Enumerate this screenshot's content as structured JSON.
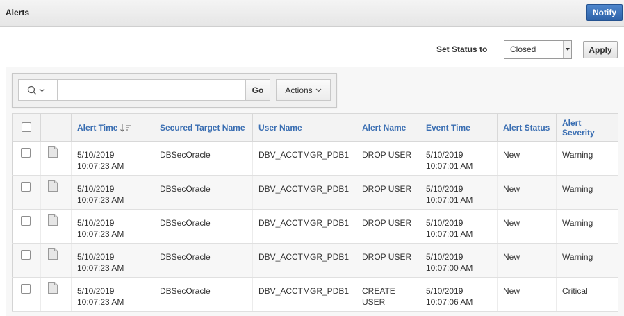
{
  "header": {
    "title": "Alerts",
    "notify_label": "Notify"
  },
  "status_controls": {
    "label": "Set Status to",
    "selected": "Closed",
    "apply_label": "Apply"
  },
  "toolbar": {
    "search_value": "",
    "go_label": "Go",
    "actions_label": "Actions"
  },
  "table": {
    "columns": [
      "Alert Time",
      "Secured Target Name",
      "User Name",
      "Alert Name",
      "Event Time",
      "Alert Status",
      "Alert Severity"
    ],
    "rows": [
      {
        "alert_time": [
          "5/10/2019",
          "10:07:23 AM"
        ],
        "target": "DBSecOracle",
        "user": "DBV_ACCTMGR_PDB1",
        "alert_name": [
          "DROP USER",
          ""
        ],
        "event_time": [
          "5/10/2019",
          "10:07:01 AM"
        ],
        "status": "New",
        "severity": "Warning"
      },
      {
        "alert_time": [
          "5/10/2019",
          "10:07:23 AM"
        ],
        "target": "DBSecOracle",
        "user": "DBV_ACCTMGR_PDB1",
        "alert_name": [
          "DROP USER",
          ""
        ],
        "event_time": [
          "5/10/2019",
          "10:07:01 AM"
        ],
        "status": "New",
        "severity": "Warning"
      },
      {
        "alert_time": [
          "5/10/2019",
          "10:07:23 AM"
        ],
        "target": "DBSecOracle",
        "user": "DBV_ACCTMGR_PDB1",
        "alert_name": [
          "DROP USER",
          ""
        ],
        "event_time": [
          "5/10/2019",
          "10:07:01 AM"
        ],
        "status": "New",
        "severity": "Warning"
      },
      {
        "alert_time": [
          "5/10/2019",
          "10:07:23 AM"
        ],
        "target": "DBSecOracle",
        "user": "DBV_ACCTMGR_PDB1",
        "alert_name": [
          "DROP USER",
          ""
        ],
        "event_time": [
          "5/10/2019",
          "10:07:00 AM"
        ],
        "status": "New",
        "severity": "Warning"
      },
      {
        "alert_time": [
          "5/10/2019",
          "10:07:23 AM"
        ],
        "target": "DBSecOracle",
        "user": "DBV_ACCTMGR_PDB1",
        "alert_name": [
          "CREATE",
          "USER"
        ],
        "event_time": [
          "5/10/2019",
          "10:07:06 AM"
        ],
        "status": "New",
        "severity": "Critical"
      }
    ]
  },
  "colors": {
    "header_link": "#3a6eb2",
    "notify_bg": "#2e63a9"
  }
}
